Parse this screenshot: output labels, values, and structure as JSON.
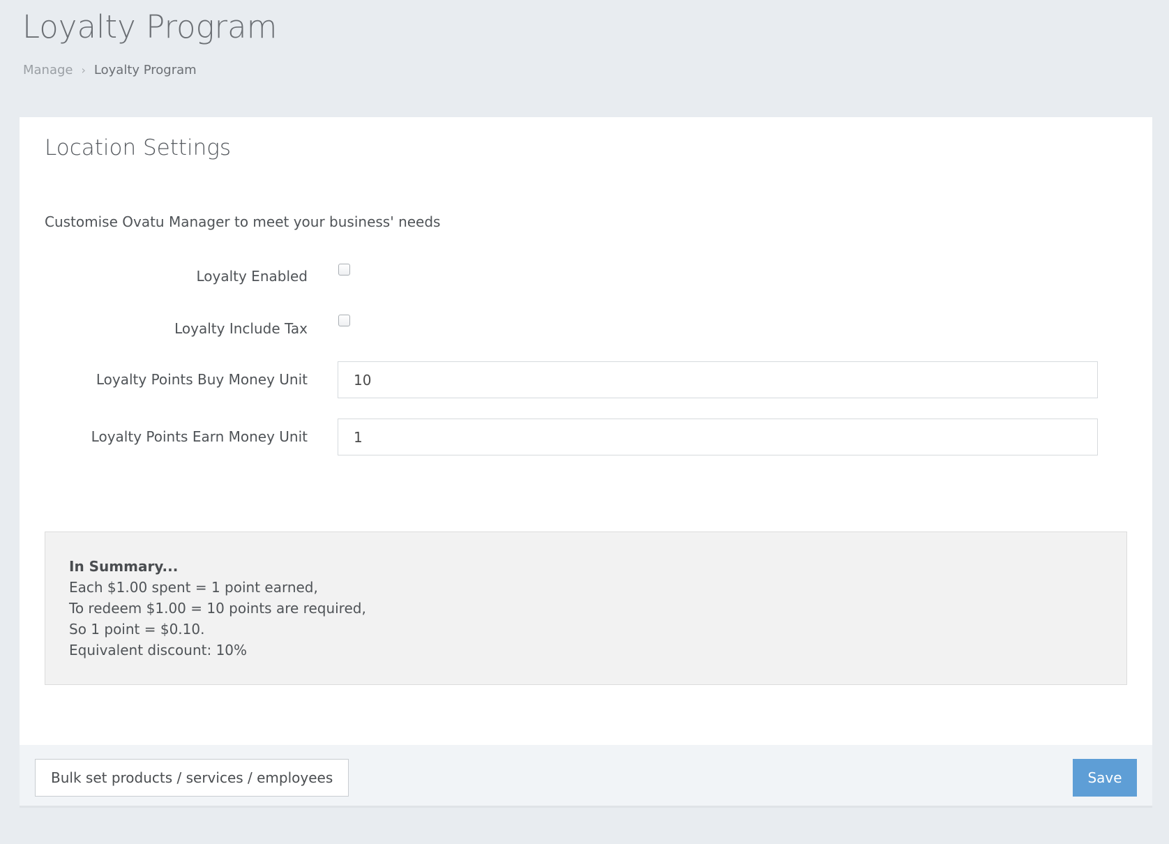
{
  "header": {
    "title": "Loyalty Program",
    "breadcrumb": {
      "parent": "Manage",
      "separator": "›",
      "current": "Loyalty Program"
    }
  },
  "panel": {
    "heading": "Location Settings",
    "description": "Customise Ovatu Manager to meet your business' needs",
    "fields": {
      "loyalty_enabled": {
        "label": "Loyalty Enabled",
        "checked": false
      },
      "loyalty_include_tax": {
        "label": "Loyalty Include Tax",
        "checked": false
      },
      "buy_money_unit": {
        "label": "Loyalty Points Buy Money Unit",
        "value": "10"
      },
      "earn_money_unit": {
        "label": "Loyalty Points Earn Money Unit",
        "value": "1"
      }
    },
    "summary": {
      "title": "In Summary...",
      "lines": [
        "Each $1.00 spent = 1 point earned,",
        "To redeem $1.00 = 10 points are required,",
        "So 1 point = $0.10.",
        "Equivalent discount: 10%"
      ]
    },
    "footer": {
      "bulk_label": "Bulk set products / services / employees",
      "save_label": "Save"
    }
  },
  "colors": {
    "background": "#e8ecf0",
    "accent": "#5e9ed6",
    "summary_bg": "#f2f2f2"
  }
}
